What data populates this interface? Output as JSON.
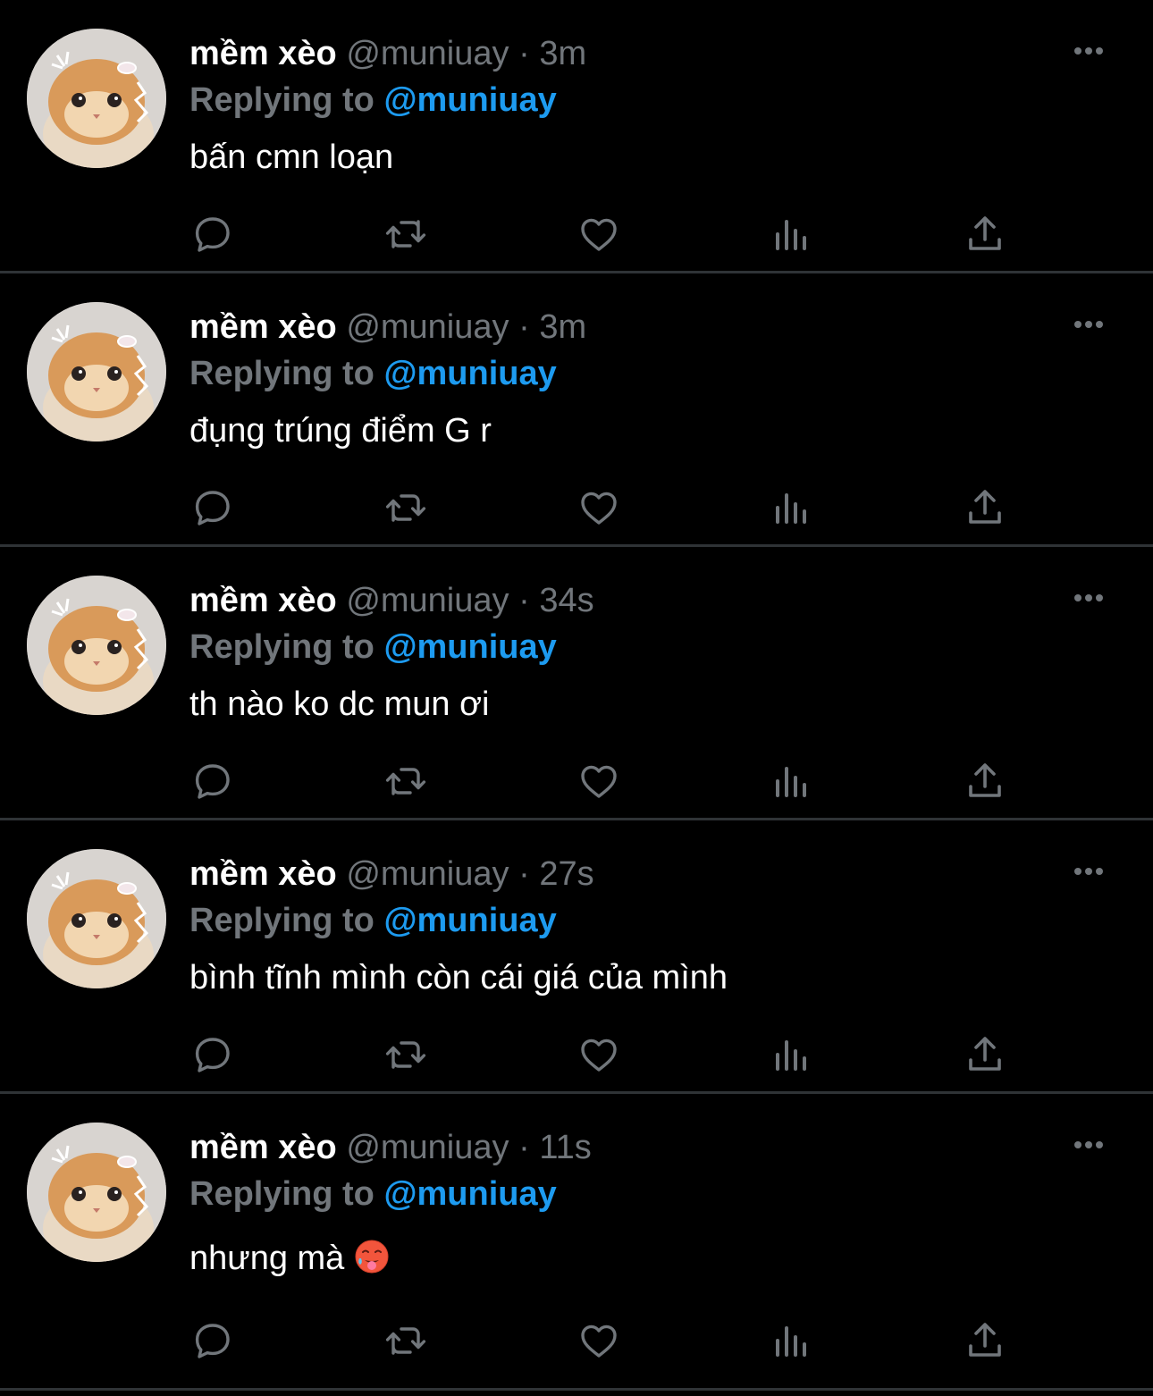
{
  "tweets": [
    {
      "name": "mềm xèo",
      "handle": "@muniuay",
      "separator": "·",
      "time": "3m",
      "reply_prefix": "Replying to",
      "reply_handle": "@muniuay",
      "text": "bấn cmn loạn",
      "emoji": ""
    },
    {
      "name": "mềm xèo",
      "handle": "@muniuay",
      "separator": "·",
      "time": "3m",
      "reply_prefix": "Replying to",
      "reply_handle": "@muniuay",
      "text": "đụng trúng điểm G r",
      "emoji": ""
    },
    {
      "name": "mềm xèo",
      "handle": "@muniuay",
      "separator": "·",
      "time": "34s",
      "reply_prefix": "Replying to",
      "reply_handle": "@muniuay",
      "text": "th nào ko dc mun ơi",
      "emoji": ""
    },
    {
      "name": "mềm xèo",
      "handle": "@muniuay",
      "separator": "·",
      "time": "27s",
      "reply_prefix": "Replying to",
      "reply_handle": "@muniuay",
      "text": "bình tĩnh mình còn cái giá của mình",
      "emoji": ""
    },
    {
      "name": "mềm xèo",
      "handle": "@muniuay",
      "separator": "·",
      "time": "11s",
      "reply_prefix": "Replying to",
      "reply_handle": "@muniuay",
      "text": "nhưng mà",
      "emoji": "hot-face-emoji"
    }
  ],
  "icons": {
    "reply": "reply-icon",
    "retweet": "retweet-icon",
    "like": "heart-icon",
    "views": "views-icon",
    "share": "share-icon",
    "more": "more-icon"
  },
  "colors": {
    "background": "#000000",
    "name": "#ffffff",
    "muted": "#71767b",
    "link": "#1d9bf0",
    "divider": "#2f3336"
  }
}
